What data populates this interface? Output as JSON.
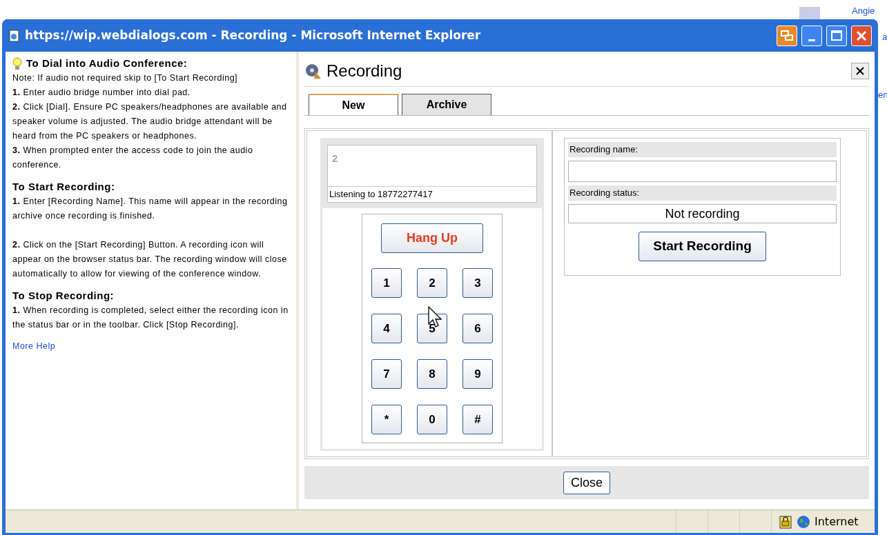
{
  "background": {
    "texts": [
      "Angie",
      "a",
      "en"
    ]
  },
  "window": {
    "title": "https://wip.webdialogs.com - Recording - Microsoft Internet Explorer"
  },
  "help": {
    "sections": [
      {
        "heading": "To Dial into Audio Conference:",
        "blocks": [
          [
            "Note: If audio not required skip to [To Start Recording]",
            "**1.** Enter audio bridge number into dial pad.",
            "**2.** Click [Dial]. Ensure PC speakers/headphones are available and speaker volume is adjusted. The audio bridge attendant will be heard from the PC speakers or headphones.",
            "**3.** When prompted enter the access code to join the audio conference."
          ]
        ]
      },
      {
        "heading": "To Start Recording:",
        "blocks": [
          [
            "**1.** Enter [Recording Name]. This name will appear in the recording archive once recording is finished."
          ],
          [
            "**2.** Click on the [Start Recording] Button. A recording icon will appear on the browser status bar. The recording window will close automatically to allow for viewing of the conference window."
          ]
        ]
      },
      {
        "heading": "To Stop Recording:",
        "blocks": [
          [
            "**1.** When recording is completed, select either the recording icon in the status bar or in the toolbar. Click [Stop Recording]."
          ]
        ]
      }
    ],
    "link": "More Help"
  },
  "panel": {
    "title": "Recording",
    "tabs": [
      {
        "label": "New",
        "selected": true
      },
      {
        "label": "Archive",
        "selected": false
      }
    ]
  },
  "dialer": {
    "display": "2",
    "status": "Listening to 18772277417",
    "hang_up": "Hang Up",
    "keys": [
      "1",
      "2",
      "3",
      "4",
      "5",
      "6",
      "7",
      "8",
      "9",
      "*",
      "0",
      "#"
    ]
  },
  "recording": {
    "name_label": "Recording name:",
    "status_label": "Recording status:",
    "status_value": "Not recording",
    "start_button": "Start Recording"
  },
  "footer": {
    "close_button": "Close"
  },
  "status_bar": {
    "zone": "Internet"
  }
}
